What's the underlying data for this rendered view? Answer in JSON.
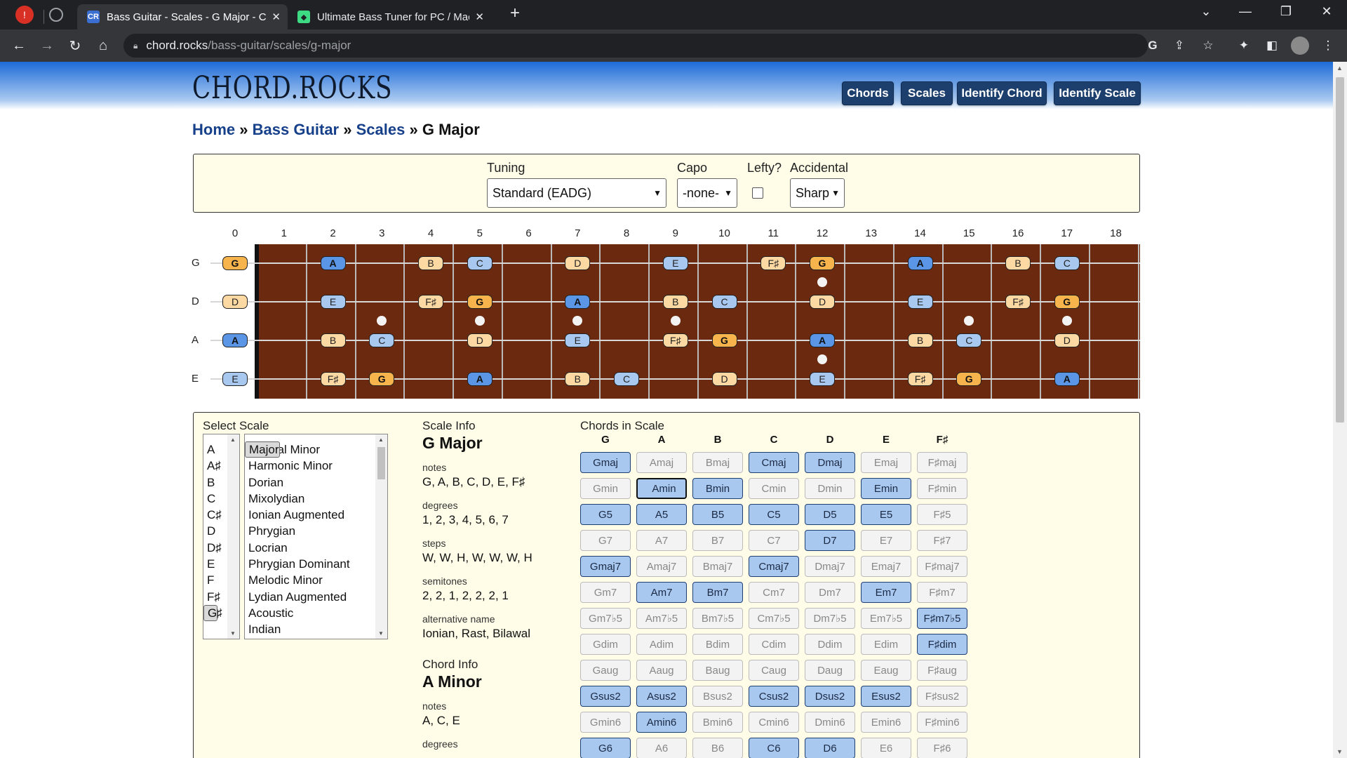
{
  "browser": {
    "tabs": [
      {
        "title": "Bass Guitar - Scales - G Major - C",
        "active": true
      },
      {
        "title": "Ultimate Bass Tuner for PC / Mac",
        "active": false
      }
    ],
    "url_host": "chord.rocks",
    "url_path": "/bass-guitar/scales/g-major"
  },
  "site": {
    "logo": "CHORD.ROCKS",
    "nav": [
      "Chords",
      "Scales",
      "Identify Chord",
      "Identify Scale"
    ]
  },
  "breadcrumb": {
    "items": [
      "Home",
      "Bass Guitar",
      "Scales"
    ],
    "sep": "»",
    "current": "G Major"
  },
  "settings": {
    "tuning_label": "Tuning",
    "tuning_value": "Standard (EADG)",
    "capo_label": "Capo",
    "capo_value": "-none-",
    "lefty_label": "Lefty?",
    "lefty_checked": false,
    "accidental_label": "Accidental",
    "accidental_value": "Sharp"
  },
  "fretboard": {
    "fret_numbers": [
      "0",
      "1",
      "2",
      "3",
      "4",
      "5",
      "6",
      "7",
      "8",
      "9",
      "10",
      "11",
      "12",
      "13",
      "14",
      "15",
      "16",
      "17",
      "18"
    ],
    "strings": [
      "G",
      "D",
      "A",
      "E"
    ],
    "notes": [
      {
        "s": 0,
        "f": 0,
        "n": "G",
        "k": "root"
      },
      {
        "s": 0,
        "f": 2,
        "n": "A",
        "k": "hl"
      },
      {
        "s": 0,
        "f": 4,
        "n": "B",
        "k": "orange"
      },
      {
        "s": 0,
        "f": 5,
        "n": "C",
        "k": "blue"
      },
      {
        "s": 0,
        "f": 7,
        "n": "D",
        "k": "orange"
      },
      {
        "s": 0,
        "f": 9,
        "n": "E",
        "k": "blue"
      },
      {
        "s": 0,
        "f": 11,
        "n": "F♯",
        "k": "orange"
      },
      {
        "s": 0,
        "f": 12,
        "n": "G",
        "k": "root"
      },
      {
        "s": 0,
        "f": 14,
        "n": "A",
        "k": "hl"
      },
      {
        "s": 0,
        "f": 16,
        "n": "B",
        "k": "orange"
      },
      {
        "s": 0,
        "f": 17,
        "n": "C",
        "k": "blue"
      },
      {
        "s": 1,
        "f": 0,
        "n": "D",
        "k": "orange"
      },
      {
        "s": 1,
        "f": 2,
        "n": "E",
        "k": "blue"
      },
      {
        "s": 1,
        "f": 4,
        "n": "F♯",
        "k": "orange"
      },
      {
        "s": 1,
        "f": 5,
        "n": "G",
        "k": "root"
      },
      {
        "s": 1,
        "f": 7,
        "n": "A",
        "k": "hl"
      },
      {
        "s": 1,
        "f": 9,
        "n": "B",
        "k": "orange"
      },
      {
        "s": 1,
        "f": 10,
        "n": "C",
        "k": "blue"
      },
      {
        "s": 1,
        "f": 12,
        "n": "D",
        "k": "orange"
      },
      {
        "s": 1,
        "f": 14,
        "n": "E",
        "k": "blue"
      },
      {
        "s": 1,
        "f": 16,
        "n": "F♯",
        "k": "orange"
      },
      {
        "s": 1,
        "f": 17,
        "n": "G",
        "k": "root"
      },
      {
        "s": 2,
        "f": 0,
        "n": "A",
        "k": "hl"
      },
      {
        "s": 2,
        "f": 2,
        "n": "B",
        "k": "orange"
      },
      {
        "s": 2,
        "f": 3,
        "n": "C",
        "k": "blue"
      },
      {
        "s": 2,
        "f": 5,
        "n": "D",
        "k": "orange"
      },
      {
        "s": 2,
        "f": 7,
        "n": "E",
        "k": "blue"
      },
      {
        "s": 2,
        "f": 9,
        "n": "F♯",
        "k": "orange"
      },
      {
        "s": 2,
        "f": 10,
        "n": "G",
        "k": "root"
      },
      {
        "s": 2,
        "f": 12,
        "n": "A",
        "k": "hl"
      },
      {
        "s": 2,
        "f": 14,
        "n": "B",
        "k": "orange"
      },
      {
        "s": 2,
        "f": 15,
        "n": "C",
        "k": "blue"
      },
      {
        "s": 2,
        "f": 17,
        "n": "D",
        "k": "orange"
      },
      {
        "s": 3,
        "f": 0,
        "n": "E",
        "k": "blue"
      },
      {
        "s": 3,
        "f": 2,
        "n": "F♯",
        "k": "orange"
      },
      {
        "s": 3,
        "f": 3,
        "n": "G",
        "k": "root"
      },
      {
        "s": 3,
        "f": 5,
        "n": "A",
        "k": "hl"
      },
      {
        "s": 3,
        "f": 7,
        "n": "B",
        "k": "orange"
      },
      {
        "s": 3,
        "f": 8,
        "n": "C",
        "k": "blue"
      },
      {
        "s": 3,
        "f": 10,
        "n": "D",
        "k": "orange"
      },
      {
        "s": 3,
        "f": 12,
        "n": "E",
        "k": "blue"
      },
      {
        "s": 3,
        "f": 14,
        "n": "F♯",
        "k": "orange"
      },
      {
        "s": 3,
        "f": 15,
        "n": "G",
        "k": "root"
      },
      {
        "s": 3,
        "f": 17,
        "n": "A",
        "k": "hl"
      }
    ]
  },
  "select_scale": {
    "label": "Select Scale",
    "roots": [
      "A",
      "A♯",
      "B",
      "C",
      "C♯",
      "D",
      "D♯",
      "E",
      "F",
      "F♯",
      "G",
      "G♯"
    ],
    "selected_root": "G",
    "scales": [
      "Major",
      "Natural Minor",
      "Harmonic Minor",
      "Dorian",
      "Mixolydian",
      "Ionian Augmented",
      "Phrygian",
      "Locrian",
      "Phrygian Dominant",
      "Melodic Minor",
      "Lydian Augmented",
      "Acoustic",
      "Indian"
    ],
    "selected_scale": "Major"
  },
  "scale_info": {
    "heading": "Scale Info",
    "name": "G Major",
    "notes_label": "notes",
    "notes": "G, A, B, C, D, E, F♯",
    "degrees_label": "degrees",
    "degrees": "1, 2, 3, 4, 5, 6, 7",
    "steps_label": "steps",
    "steps": "W, W, H, W, W, W, H",
    "semitones_label": "semitones",
    "semitones": "2, 2, 1, 2, 2, 2, 1",
    "alt_label": "alternative name",
    "alt": "Ionian, Rast, Bilawal"
  },
  "chord_info": {
    "heading": "Chord Info",
    "name": "A Minor",
    "notes_label": "notes",
    "notes": "A, C, E",
    "degrees_label": "degrees"
  },
  "chords_in_scale": {
    "heading": "Chords in Scale",
    "roots": [
      "G",
      "A",
      "B",
      "C",
      "D",
      "E",
      "F♯"
    ],
    "rows": [
      {
        "suffix": "maj",
        "on": [
          1,
          0,
          0,
          1,
          1,
          0,
          0
        ]
      },
      {
        "suffix": "min",
        "on": [
          0,
          1,
          1,
          0,
          0,
          1,
          0
        ]
      },
      {
        "suffix": "5",
        "on": [
          1,
          1,
          1,
          1,
          1,
          1,
          0
        ]
      },
      {
        "suffix": "7",
        "on": [
          0,
          0,
          0,
          0,
          1,
          0,
          0
        ]
      },
      {
        "suffix": "maj7",
        "on": [
          1,
          0,
          0,
          1,
          0,
          0,
          0
        ]
      },
      {
        "suffix": "m7",
        "on": [
          0,
          1,
          1,
          0,
          0,
          1,
          0
        ]
      },
      {
        "suffix": "m7♭5",
        "on": [
          0,
          0,
          0,
          0,
          0,
          0,
          1
        ]
      },
      {
        "suffix": "dim",
        "on": [
          0,
          0,
          0,
          0,
          0,
          0,
          1
        ]
      },
      {
        "suffix": "aug",
        "on": [
          0,
          0,
          0,
          0,
          0,
          0,
          0
        ]
      },
      {
        "suffix": "sus2",
        "on": [
          1,
          1,
          0,
          1,
          1,
          1,
          0
        ]
      },
      {
        "suffix": "min6",
        "on": [
          0,
          1,
          0,
          0,
          0,
          0,
          0
        ]
      },
      {
        "suffix": "6",
        "on": [
          1,
          0,
          0,
          1,
          1,
          0,
          0
        ]
      }
    ],
    "selected": "Amin"
  }
}
